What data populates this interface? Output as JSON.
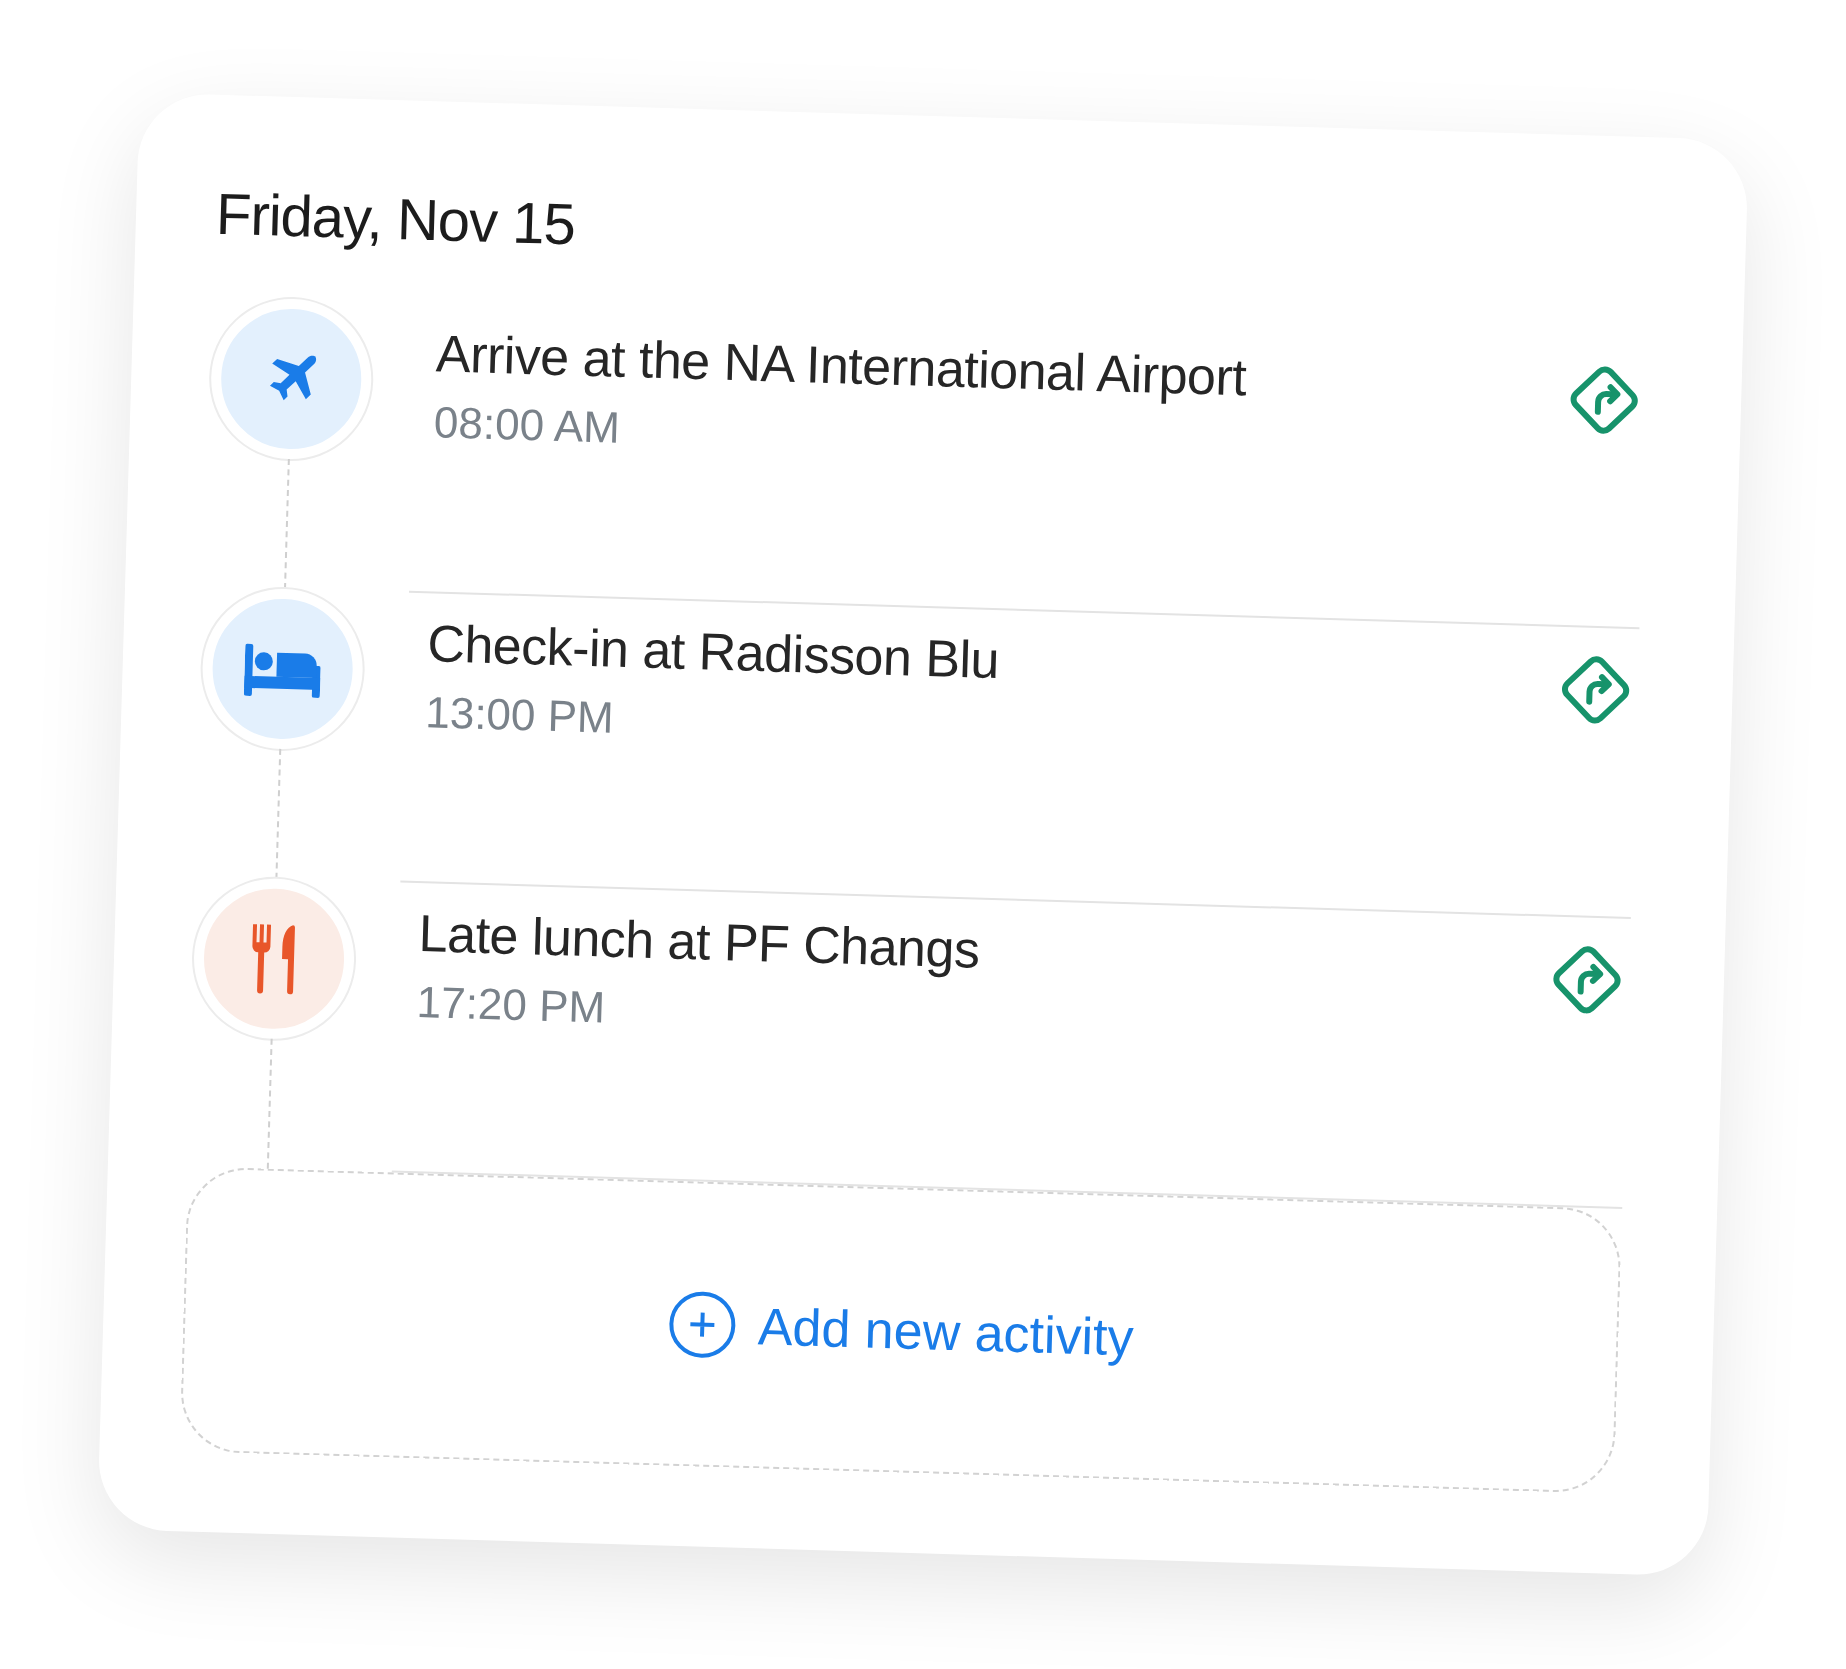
{
  "date_title": "Friday, Nov 15",
  "activities": [
    {
      "title": "Arrive at the NA International Airport",
      "time": "08:00 AM",
      "kind": "flight"
    },
    {
      "title": "Check-in at Radisson Blu",
      "time": "13:00 PM",
      "kind": "hotel"
    },
    {
      "title": "Late lunch at PF Changs",
      "time": "17:20 PM",
      "kind": "food"
    }
  ],
  "add_button": {
    "label": "Add new activity"
  }
}
